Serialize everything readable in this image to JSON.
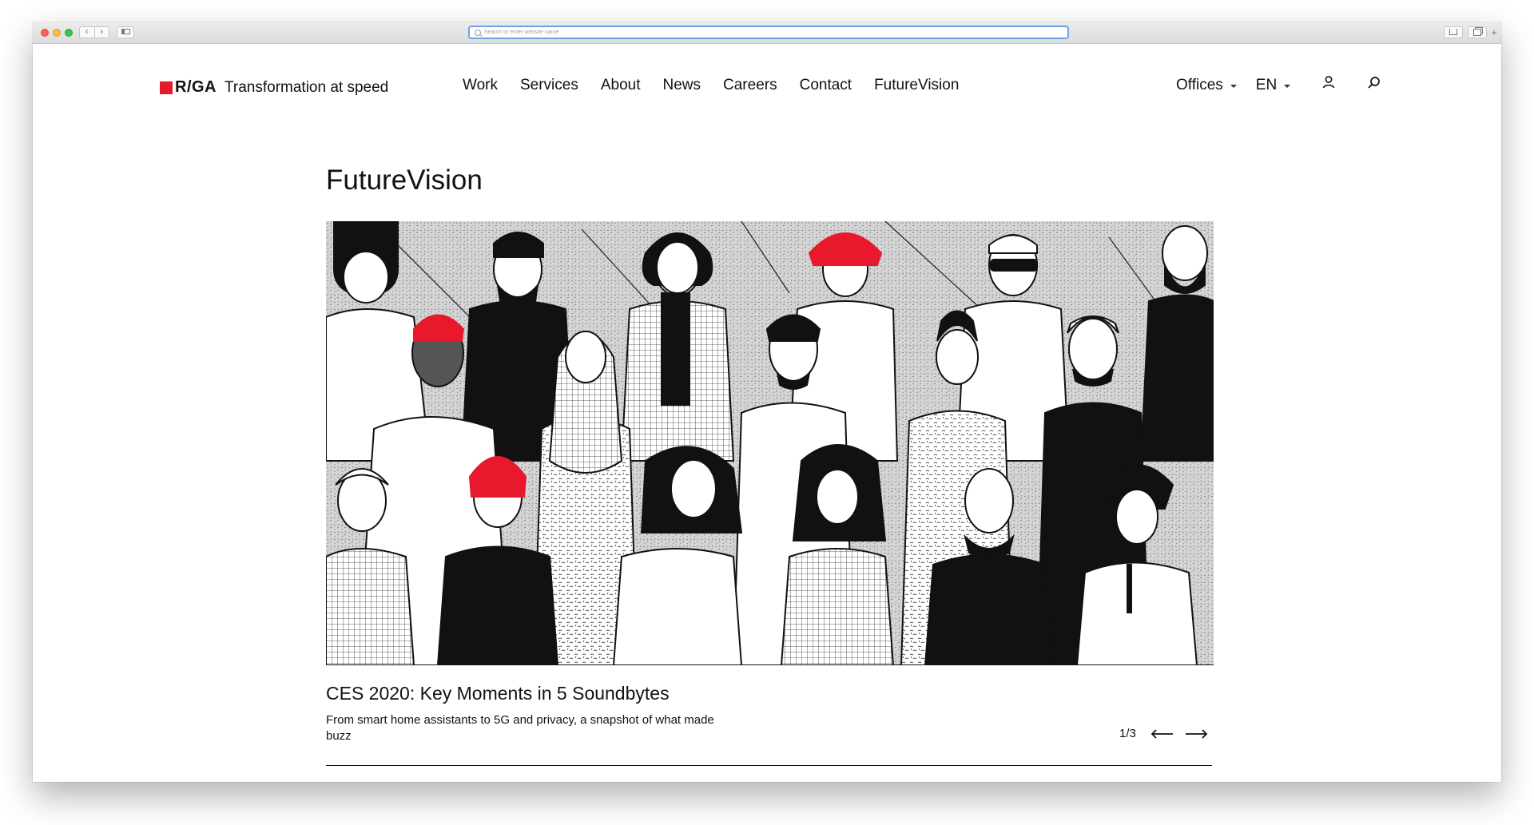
{
  "browser": {
    "address_placeholder": "Search or enter website name",
    "new_tab_symbol": "+"
  },
  "header": {
    "logo_text": "R/GA",
    "tagline": "Transformation at speed",
    "nav": [
      "Work",
      "Services",
      "About",
      "News",
      "Careers",
      "Contact",
      "FutureVision"
    ],
    "offices_label": "Offices",
    "language_label": "EN",
    "icons": [
      "user-icon",
      "search-icon"
    ]
  },
  "main": {
    "page_title": "FutureVision",
    "article": {
      "title": "CES 2020: Key Moments in 5 Soundbytes",
      "description": "From smart home assistants to 5G and privacy, a snapshot of what made buzz"
    },
    "pager": {
      "count": "1/3",
      "prev_icon": "arrow-left-icon",
      "next_icon": "arrow-right-icon"
    }
  },
  "colors": {
    "brand_red": "#e8192c",
    "text": "#111111",
    "address_focus": "#6ea0e8"
  }
}
